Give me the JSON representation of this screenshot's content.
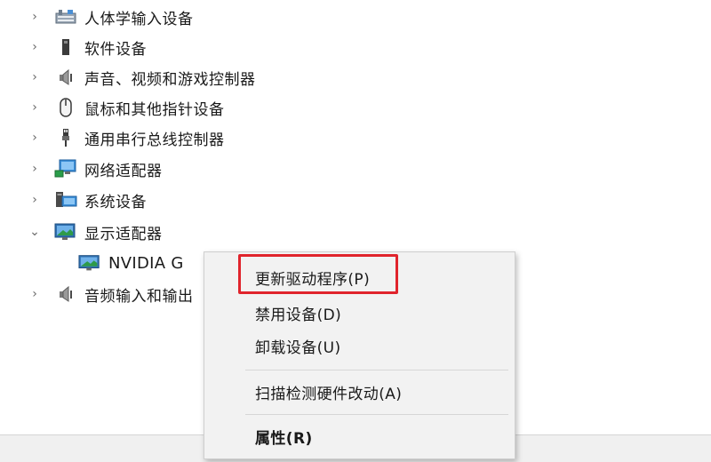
{
  "tree": {
    "items": [
      {
        "label": "人体学输入设备",
        "expanded": false,
        "icon": "hid-device-icon"
      },
      {
        "label": "软件设备",
        "expanded": false,
        "icon": "software-device-icon"
      },
      {
        "label": "声音、视频和游戏控制器",
        "expanded": false,
        "icon": "speaker-icon"
      },
      {
        "label": "鼠标和其他指针设备",
        "expanded": false,
        "icon": "mouse-icon"
      },
      {
        "label": "通用串行总线控制器",
        "expanded": false,
        "icon": "usb-icon"
      },
      {
        "label": "网络适配器",
        "expanded": false,
        "icon": "network-adapter-icon"
      },
      {
        "label": "系统设备",
        "expanded": false,
        "icon": "system-device-icon"
      },
      {
        "label": "显示适配器",
        "expanded": true,
        "icon": "display-adapter-icon"
      },
      {
        "label": "音频输入和输出",
        "expanded": false,
        "icon": "audio-io-icon"
      }
    ],
    "child": {
      "label": "NVIDIA G",
      "icon": "gpu-icon"
    }
  },
  "context_menu": {
    "items": [
      {
        "label": "更新驱动程序(P)",
        "highlighted": true
      },
      {
        "label": "禁用设备(D)"
      },
      {
        "label": "卸载设备(U)"
      },
      {
        "label": "扫描检测硬件改动(A)"
      },
      {
        "label": "属性(R)",
        "bold": true
      }
    ]
  },
  "colors": {
    "highlight_border": "#e0242c",
    "menu_bg": "#f2f2f2"
  }
}
